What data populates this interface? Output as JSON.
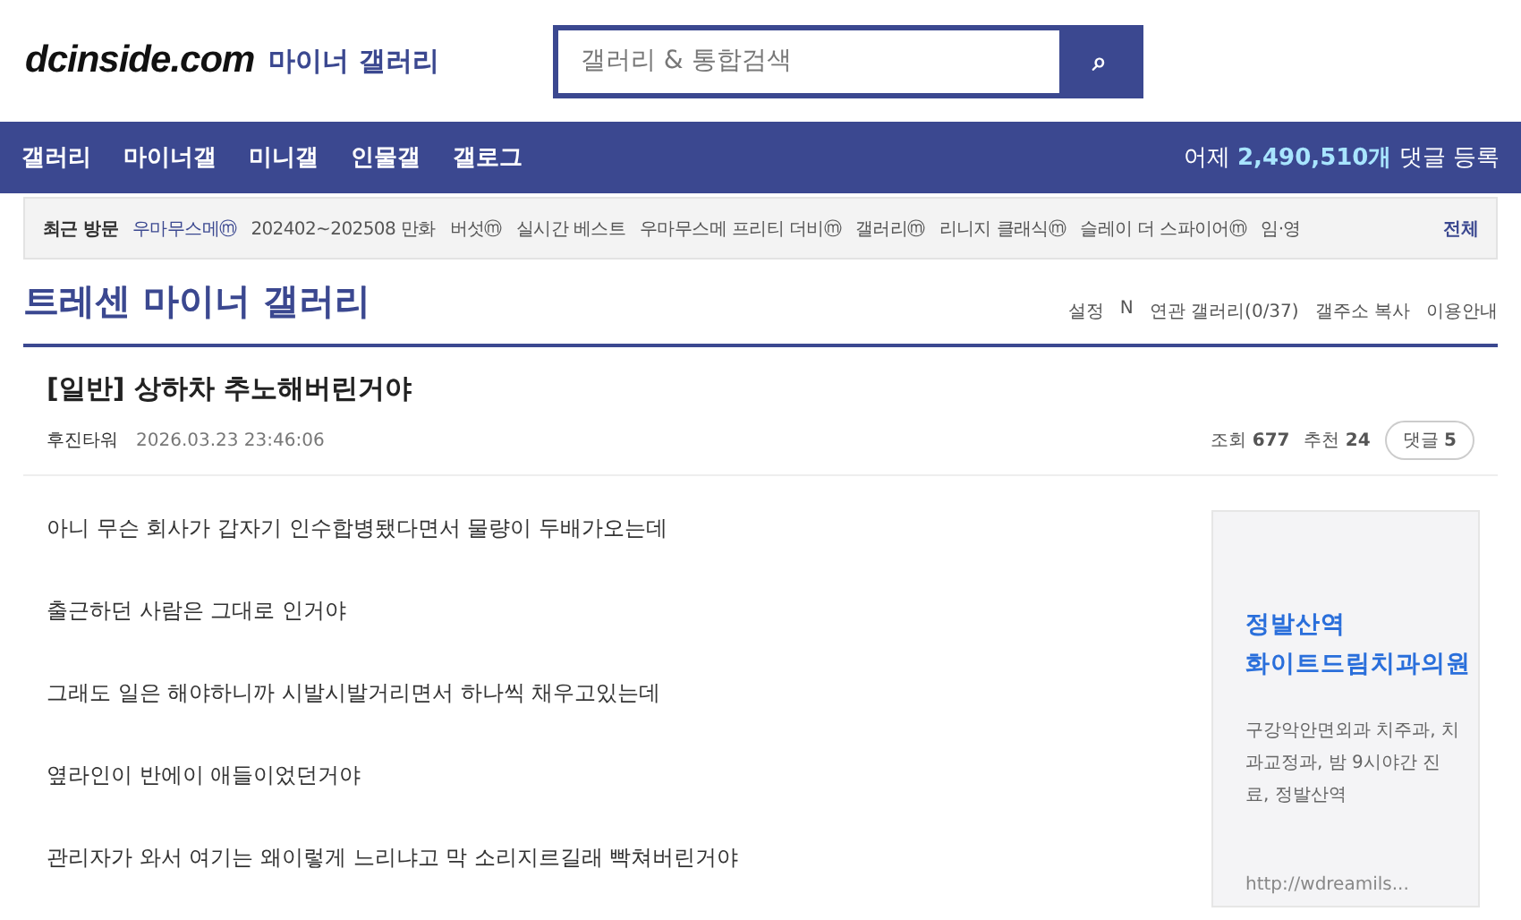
{
  "header": {
    "logo": "dcinside.com",
    "section": "마이너 갤러리",
    "search": {
      "placeholder": "갤러리 & 통합검색",
      "button": "⌕"
    }
  },
  "nav": {
    "items": [
      "갤러리",
      "마이너갤",
      "미니갤",
      "인물갤",
      "갤로그"
    ],
    "stats": {
      "prefix": "어제",
      "count": "2,490,510개",
      "suffix": "댓글 등록"
    }
  },
  "recent": {
    "label": "최근 방문",
    "items": [
      {
        "text": "우마무스메ⓜ",
        "selected": true
      },
      {
        "text": "202402~202508 만화",
        "selected": false
      },
      {
        "text": "버섯ⓜ",
        "selected": false
      },
      {
        "text": "실시간 베스트",
        "selected": false
      },
      {
        "text": "우마무스메 프리티 더비ⓜ",
        "selected": false
      },
      {
        "text": "갤러리ⓜ",
        "selected": false
      },
      {
        "text": "리니지 클래식ⓜ",
        "selected": false
      },
      {
        "text": "슬레이 더 스파이어ⓜ",
        "selected": false
      },
      {
        "text": "임·영",
        "selected": false
      }
    ],
    "all": "전체"
  },
  "gallery": {
    "title": "트레센 마이너 갤러리",
    "links": [
      "설정",
      "N",
      "연관 갤러리(0/37)",
      "갤주소 복사",
      "이용안내"
    ]
  },
  "post": {
    "title": "[일반] 상하차 추노해버린거야",
    "author": "후진타워",
    "date": "2026.03.23 23:46:06",
    "views_label": "조회",
    "views": "677",
    "likes_label": "추천",
    "likes": "24",
    "comments_label": "댓글",
    "comments": "5",
    "paragraphs": [
      "아니 무슨 회사가 갑자기 인수합병됐다면서 물량이 두배가오는데",
      "출근하던 사람은 그대로 인거야",
      "그래도 일은 해야하니까 시발시발거리면서 하나씩 채우고있는데",
      "옆라인이 반에이 애들이었던거야",
      "관리자가 와서 여기는 왜이렇게 느리냐고 막 소리지르길래 빡쳐버린거야"
    ]
  },
  "ad": {
    "title_lines": [
      "정발산역",
      "화이트드림치과의원"
    ],
    "description": "구강악안면외과 치주과, 치과교정과, 밤 9시야간 진료, 정발산역",
    "url": "http://wdreamils..."
  }
}
